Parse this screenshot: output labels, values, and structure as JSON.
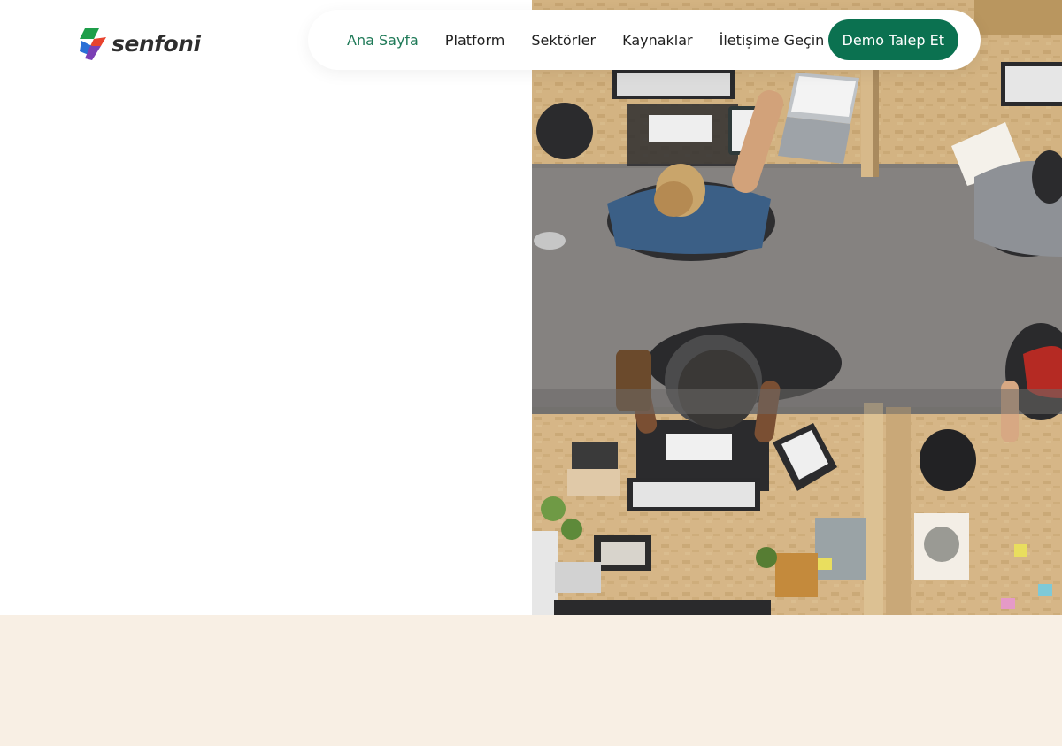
{
  "brand": {
    "name": "senfoni",
    "logo_colors": [
      "#1e9e4a",
      "#e8432e",
      "#2a6fd6",
      "#7b3fb5"
    ]
  },
  "nav": {
    "items": [
      {
        "label": "Ana Sayfa",
        "active": true
      },
      {
        "label": "Platform",
        "active": false
      },
      {
        "label": "Sektörler",
        "active": false
      },
      {
        "label": "Kaynaklar",
        "active": false
      },
      {
        "label": "İletişime Geçin",
        "active": false
      }
    ],
    "cta_label": "Demo Talep Et",
    "active_color": "#1f7a58",
    "cta_color": "#0b7150"
  },
  "hero": {
    "image_description_icon": "office-photo",
    "bottom_band_color": "#f8efe4"
  }
}
